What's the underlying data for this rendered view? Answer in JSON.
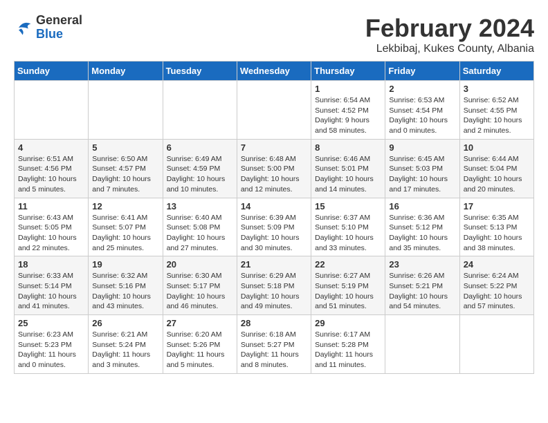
{
  "header": {
    "logo_general": "General",
    "logo_blue": "Blue",
    "month_title": "February 2024",
    "location": "Lekbibaj, Kukes County, Albania"
  },
  "days_of_week": [
    "Sunday",
    "Monday",
    "Tuesday",
    "Wednesday",
    "Thursday",
    "Friday",
    "Saturday"
  ],
  "weeks": [
    [
      {
        "day": "",
        "info": ""
      },
      {
        "day": "",
        "info": ""
      },
      {
        "day": "",
        "info": ""
      },
      {
        "day": "",
        "info": ""
      },
      {
        "day": "1",
        "info": "Sunrise: 6:54 AM\nSunset: 4:52 PM\nDaylight: 9 hours and 58 minutes."
      },
      {
        "day": "2",
        "info": "Sunrise: 6:53 AM\nSunset: 4:54 PM\nDaylight: 10 hours and 0 minutes."
      },
      {
        "day": "3",
        "info": "Sunrise: 6:52 AM\nSunset: 4:55 PM\nDaylight: 10 hours and 2 minutes."
      }
    ],
    [
      {
        "day": "4",
        "info": "Sunrise: 6:51 AM\nSunset: 4:56 PM\nDaylight: 10 hours and 5 minutes."
      },
      {
        "day": "5",
        "info": "Sunrise: 6:50 AM\nSunset: 4:57 PM\nDaylight: 10 hours and 7 minutes."
      },
      {
        "day": "6",
        "info": "Sunrise: 6:49 AM\nSunset: 4:59 PM\nDaylight: 10 hours and 10 minutes."
      },
      {
        "day": "7",
        "info": "Sunrise: 6:48 AM\nSunset: 5:00 PM\nDaylight: 10 hours and 12 minutes."
      },
      {
        "day": "8",
        "info": "Sunrise: 6:46 AM\nSunset: 5:01 PM\nDaylight: 10 hours and 14 minutes."
      },
      {
        "day": "9",
        "info": "Sunrise: 6:45 AM\nSunset: 5:03 PM\nDaylight: 10 hours and 17 minutes."
      },
      {
        "day": "10",
        "info": "Sunrise: 6:44 AM\nSunset: 5:04 PM\nDaylight: 10 hours and 20 minutes."
      }
    ],
    [
      {
        "day": "11",
        "info": "Sunrise: 6:43 AM\nSunset: 5:05 PM\nDaylight: 10 hours and 22 minutes."
      },
      {
        "day": "12",
        "info": "Sunrise: 6:41 AM\nSunset: 5:07 PM\nDaylight: 10 hours and 25 minutes."
      },
      {
        "day": "13",
        "info": "Sunrise: 6:40 AM\nSunset: 5:08 PM\nDaylight: 10 hours and 27 minutes."
      },
      {
        "day": "14",
        "info": "Sunrise: 6:39 AM\nSunset: 5:09 PM\nDaylight: 10 hours and 30 minutes."
      },
      {
        "day": "15",
        "info": "Sunrise: 6:37 AM\nSunset: 5:10 PM\nDaylight: 10 hours and 33 minutes."
      },
      {
        "day": "16",
        "info": "Sunrise: 6:36 AM\nSunset: 5:12 PM\nDaylight: 10 hours and 35 minutes."
      },
      {
        "day": "17",
        "info": "Sunrise: 6:35 AM\nSunset: 5:13 PM\nDaylight: 10 hours and 38 minutes."
      }
    ],
    [
      {
        "day": "18",
        "info": "Sunrise: 6:33 AM\nSunset: 5:14 PM\nDaylight: 10 hours and 41 minutes."
      },
      {
        "day": "19",
        "info": "Sunrise: 6:32 AM\nSunset: 5:16 PM\nDaylight: 10 hours and 43 minutes."
      },
      {
        "day": "20",
        "info": "Sunrise: 6:30 AM\nSunset: 5:17 PM\nDaylight: 10 hours and 46 minutes."
      },
      {
        "day": "21",
        "info": "Sunrise: 6:29 AM\nSunset: 5:18 PM\nDaylight: 10 hours and 49 minutes."
      },
      {
        "day": "22",
        "info": "Sunrise: 6:27 AM\nSunset: 5:19 PM\nDaylight: 10 hours and 51 minutes."
      },
      {
        "day": "23",
        "info": "Sunrise: 6:26 AM\nSunset: 5:21 PM\nDaylight: 10 hours and 54 minutes."
      },
      {
        "day": "24",
        "info": "Sunrise: 6:24 AM\nSunset: 5:22 PM\nDaylight: 10 hours and 57 minutes."
      }
    ],
    [
      {
        "day": "25",
        "info": "Sunrise: 6:23 AM\nSunset: 5:23 PM\nDaylight: 11 hours and 0 minutes."
      },
      {
        "day": "26",
        "info": "Sunrise: 6:21 AM\nSunset: 5:24 PM\nDaylight: 11 hours and 3 minutes."
      },
      {
        "day": "27",
        "info": "Sunrise: 6:20 AM\nSunset: 5:26 PM\nDaylight: 11 hours and 5 minutes."
      },
      {
        "day": "28",
        "info": "Sunrise: 6:18 AM\nSunset: 5:27 PM\nDaylight: 11 hours and 8 minutes."
      },
      {
        "day": "29",
        "info": "Sunrise: 6:17 AM\nSunset: 5:28 PM\nDaylight: 11 hours and 11 minutes."
      },
      {
        "day": "",
        "info": ""
      },
      {
        "day": "",
        "info": ""
      }
    ]
  ]
}
